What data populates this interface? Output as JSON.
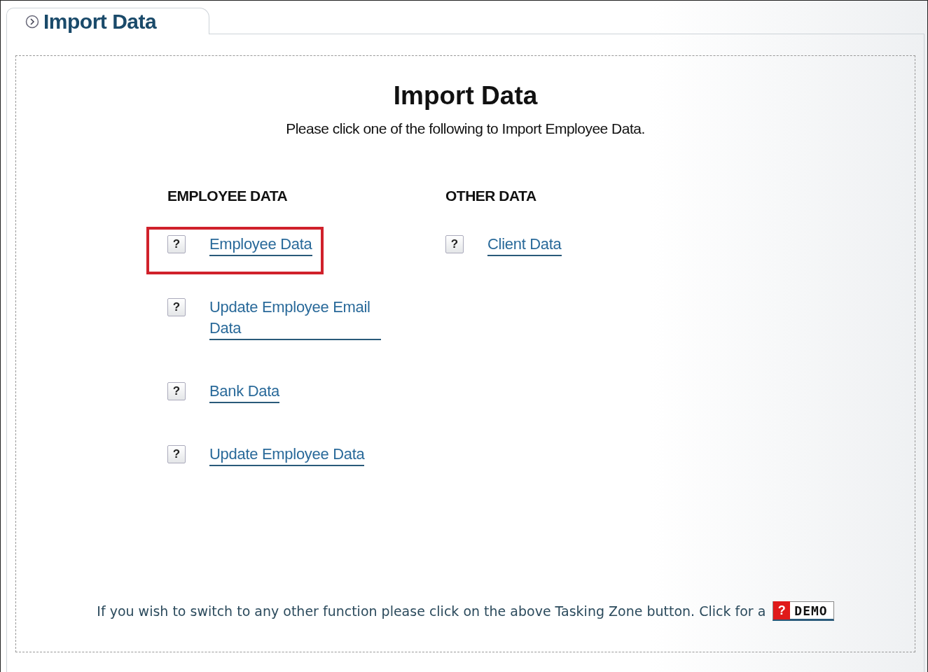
{
  "tab": {
    "title": "Import Data"
  },
  "heading": "Import Data",
  "subtitle": "Please click one of the following to Import Employee Data.",
  "columns": [
    {
      "title": "EMPLOYEE DATA",
      "items": [
        {
          "help": "?",
          "label": "Employee Data",
          "highlighted": true
        },
        {
          "help": "?",
          "label": "Update Employee Email Data",
          "highlighted": false
        },
        {
          "help": "?",
          "label": "Bank Data",
          "highlighted": false
        },
        {
          "help": "?",
          "label": "Update Employee Data",
          "highlighted": false
        }
      ]
    },
    {
      "title": "OTHER DATA",
      "items": [
        {
          "help": "?",
          "label": "Client Data",
          "highlighted": false
        }
      ]
    }
  ],
  "footer": {
    "text": "If you wish to switch to any other function please click on the above Tasking Zone button. Click for a",
    "demo_icon": "?",
    "demo_label": "DEMO"
  }
}
